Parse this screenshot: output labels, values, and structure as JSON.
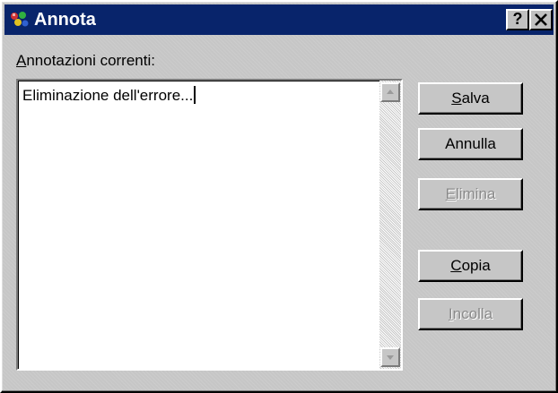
{
  "window": {
    "title": "Annota",
    "help_label": "?",
    "colors": {
      "titlebar": "#08246b",
      "face": "#c6c6c6"
    }
  },
  "annotations_label": {
    "mnemonic": "A",
    "rest": "nnotazioni correnti:"
  },
  "textarea": {
    "value": "Eliminazione dell'errore..."
  },
  "buttons": {
    "salva": {
      "mnemonic": "S",
      "rest": "alva",
      "enabled": true
    },
    "annulla": {
      "label": "Annulla",
      "enabled": true
    },
    "elimina": {
      "mnemonic": "E",
      "rest": "limina",
      "enabled": false
    },
    "copia": {
      "mnemonic": "C",
      "rest": "opia",
      "enabled": true
    },
    "incolla": {
      "mnemonic": "I",
      "rest": "ncolla",
      "enabled": false
    }
  },
  "icons": {
    "app": "notes-app-icon",
    "help": "help-icon",
    "close": "close-icon",
    "scroll_up": "arrow-up-icon",
    "scroll_down": "arrow-down-icon"
  }
}
